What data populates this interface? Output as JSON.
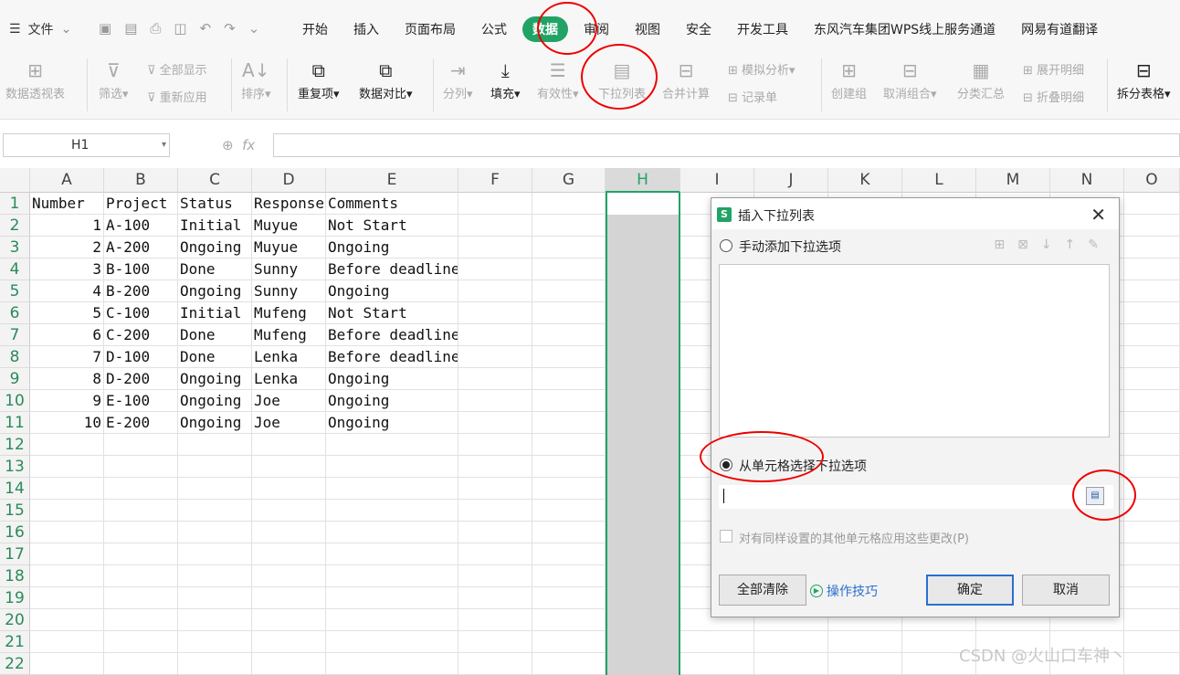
{
  "menu": {
    "file": "文件"
  },
  "tabs": [
    "开始",
    "插入",
    "页面布局",
    "公式",
    "数据",
    "审阅",
    "视图",
    "安全",
    "开发工具",
    "东风汽车集团WPS线上服务通道",
    "网易有道翻译"
  ],
  "active_tab": "数据",
  "ribbon": {
    "pivot": "数据透视表",
    "filter": "筛选",
    "show_all": "全部显示",
    "reapply": "重新应用",
    "sort": "排序",
    "duplicates": "重复项",
    "compare": "数据对比",
    "split": "分列",
    "fill": "填充",
    "validity": "有效性",
    "dropdown": "下拉列表",
    "consolidate": "合并计算",
    "simulate": "模拟分析",
    "record": "记录单",
    "group": "创建组",
    "ungroup": "取消组合",
    "subtotal": "分类汇总",
    "expand": "展开明细",
    "collapse": "折叠明细",
    "split_table": "拆分表格"
  },
  "formula_bar": {
    "cell_ref": "H1",
    "fx": "fx"
  },
  "columns": [
    "A",
    "B",
    "C",
    "D",
    "E",
    "F",
    "G",
    "H",
    "I",
    "J",
    "K",
    "L",
    "M",
    "N",
    "O"
  ],
  "rows": [
    "1",
    "2",
    "3",
    "4",
    "5",
    "6",
    "7",
    "8",
    "9",
    "10",
    "11",
    "12",
    "13",
    "14",
    "15",
    "16",
    "17",
    "18",
    "19",
    "20",
    "21",
    "22"
  ],
  "table": {
    "header": [
      "Number",
      "Project",
      "Status",
      "Response",
      "Comments"
    ],
    "rows": [
      [
        "1",
        "A-100",
        "Initial",
        "Muyue",
        "Not Start"
      ],
      [
        "2",
        "A-200",
        "Ongoing",
        "Muyue",
        "Ongoing"
      ],
      [
        "3",
        "B-100",
        "Done",
        "Sunny",
        "Before deadline"
      ],
      [
        "4",
        "B-200",
        "Ongoing",
        "Sunny",
        "Ongoing"
      ],
      [
        "5",
        "C-100",
        "Initial",
        "Mufeng",
        "Not Start"
      ],
      [
        "6",
        "C-200",
        "Done",
        "Mufeng",
        "Before deadline"
      ],
      [
        "7",
        "D-100",
        "Done",
        "Lenka",
        "Before deadline"
      ],
      [
        "8",
        "D-200",
        "Ongoing",
        "Lenka",
        "Ongoing"
      ],
      [
        "9",
        "E-100",
        "Ongoing",
        "Joe",
        "Ongoing"
      ],
      [
        "10",
        "E-200",
        "Ongoing",
        "Joe",
        "Ongoing"
      ]
    ]
  },
  "dialog": {
    "title": "插入下拉列表",
    "logo": "S",
    "manual_option": "手动添加下拉选项",
    "cell_option": "从单元格选择下拉选项",
    "range_value": "",
    "apply_same": "对有同样设置的其他单元格应用这些更改(P)",
    "clear_all": "全部清除",
    "tips": "操作技巧",
    "ok": "确定",
    "cancel": "取消"
  },
  "watermark": "CSDN @火山口车神丶",
  "colors": {
    "accent": "#21a366",
    "annotation": "#e00000",
    "primary_button": "#2a6fcf"
  }
}
